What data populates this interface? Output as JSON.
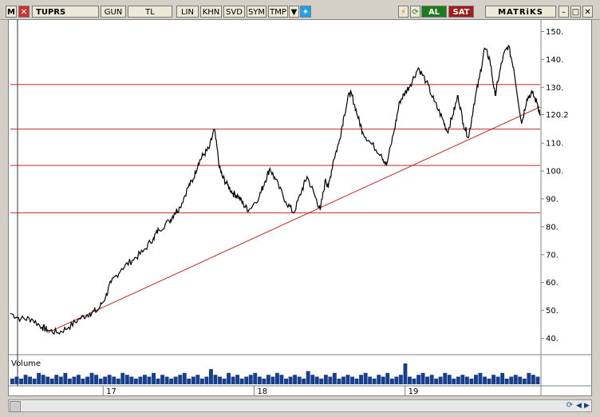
{
  "toolbar": {
    "m_label": "M",
    "symbol": "TUPRS",
    "period": "GUN",
    "currency": "TL",
    "scale": "LIN",
    "buttons": [
      "KHN",
      "SVD",
      "SYM",
      "TMP"
    ],
    "buy_label": "AL",
    "sell_label": "SAT",
    "brand": "MATRiKS"
  },
  "chart_data": {
    "type": "line",
    "ylim": [
      35,
      153
    ],
    "y_ticks": [
      "150.",
      "140.",
      "130.",
      "120.2",
      "110.",
      "100.",
      "90.",
      "80.",
      "70.",
      "60.",
      "50.",
      "40."
    ],
    "y_tick_values": [
      150,
      140,
      130,
      120.2,
      110,
      100,
      90,
      80,
      70,
      60,
      50,
      40
    ],
    "x_ticks": [
      "17",
      "18",
      "19"
    ],
    "x_tick_positions": [
      0.175,
      0.46,
      0.745
    ],
    "last_value": 120.2,
    "horizontal_lines": [
      131,
      115,
      102,
      85
    ],
    "trendline": {
      "start": [
        0.07,
        42
      ],
      "end": [
        1.0,
        123
      ]
    },
    "series": [
      {
        "x": [
          0.0,
          0.02,
          0.04,
          0.06,
          0.07,
          0.09,
          0.11,
          0.13,
          0.15,
          0.165,
          0.18,
          0.19,
          0.21,
          0.23,
          0.25,
          0.27,
          0.28,
          0.3,
          0.31,
          0.32,
          0.335,
          0.345,
          0.355,
          0.365,
          0.375,
          0.385,
          0.395,
          0.4,
          0.41,
          0.42,
          0.43,
          0.44,
          0.45,
          0.47,
          0.48,
          0.49,
          0.5,
          0.52,
          0.535,
          0.55,
          0.56,
          0.575,
          0.585,
          0.595,
          0.6,
          0.61,
          0.62,
          0.63,
          0.64,
          0.645,
          0.655,
          0.665,
          0.68,
          0.7,
          0.71,
          0.725,
          0.735,
          0.745,
          0.755,
          0.77,
          0.785,
          0.8,
          0.815,
          0.825,
          0.835,
          0.845,
          0.855,
          0.865,
          0.875,
          0.885,
          0.895,
          0.905,
          0.915,
          0.92,
          0.93,
          0.94,
          0.95,
          0.965,
          0.975,
          0.985,
          0.995,
          1.0
        ],
        "values": [
          49,
          47,
          47,
          44,
          43,
          42,
          44,
          47,
          49,
          50,
          55,
          60,
          65,
          68,
          71,
          76,
          79,
          82,
          85,
          87,
          94,
          97,
          103,
          106,
          108,
          115,
          101,
          98,
          95,
          92,
          91,
          88,
          86,
          91,
          96,
          101,
          97,
          89,
          85,
          93,
          98,
          91,
          86,
          97,
          94,
          104,
          110,
          120,
          128,
          127,
          120,
          114,
          110,
          106,
          102,
          115,
          125,
          128,
          131,
          137,
          132,
          125,
          119,
          114,
          120,
          127,
          117,
          112,
          124,
          133,
          144,
          140,
          127,
          132,
          141,
          145,
          137,
          117,
          126,
          128,
          124,
          120.2
        ]
      }
    ],
    "volume": {
      "label": "Volume",
      "values": [
        3,
        4,
        3,
        5,
        4,
        3,
        6,
        5,
        4,
        3,
        5,
        4,
        6,
        3,
        4,
        5,
        3,
        4,
        6,
        5,
        3,
        4,
        5,
        4,
        3,
        6,
        5,
        4,
        3,
        4,
        5,
        4,
        6,
        3,
        5,
        4,
        3,
        4,
        5,
        6,
        3,
        4,
        5,
        3,
        4,
        8,
        5,
        4,
        3,
        6,
        4,
        5,
        3,
        4,
        5,
        6,
        4,
        3,
        5,
        4,
        6,
        5,
        3,
        4,
        5,
        4,
        3,
        7,
        5,
        4,
        3,
        5,
        4,
        6,
        3,
        4,
        5,
        4,
        3,
        5,
        6,
        4,
        3,
        5,
        4,
        6,
        3,
        4,
        5,
        11,
        4,
        3,
        5,
        6,
        4,
        5,
        3,
        4,
        6,
        5,
        3,
        4,
        5,
        4,
        3,
        5,
        6,
        4,
        3,
        5,
        4,
        6,
        3,
        4,
        5,
        4,
        3,
        6,
        5,
        4
      ]
    }
  }
}
